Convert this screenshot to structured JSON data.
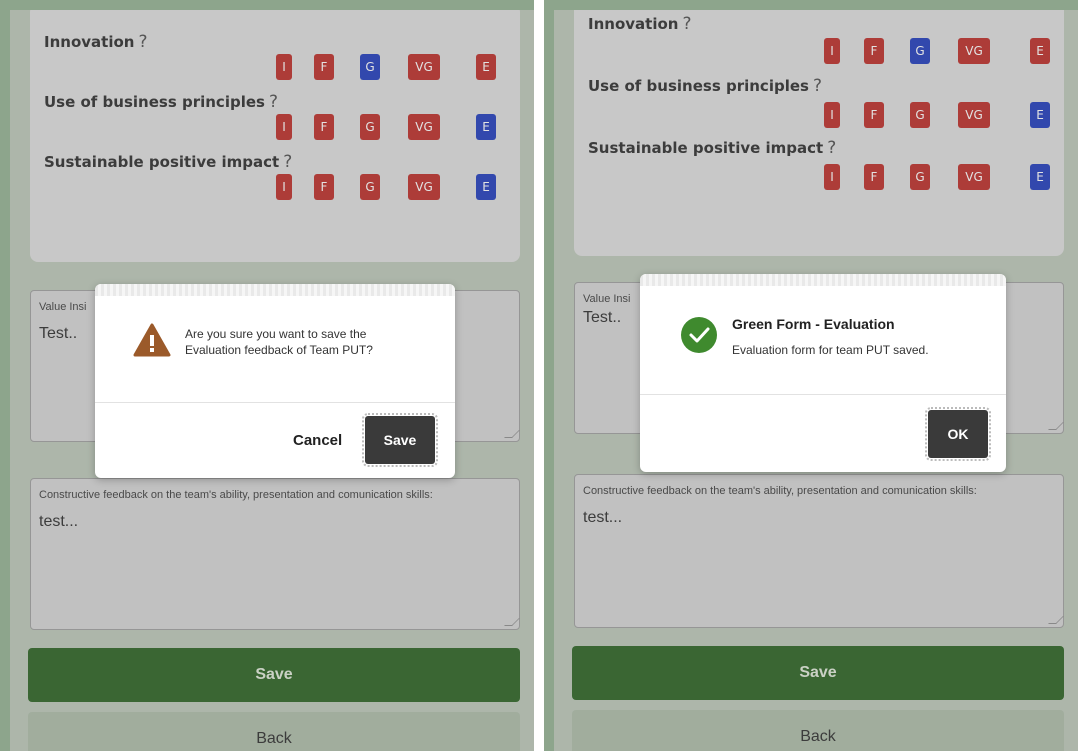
{
  "criteria": [
    {
      "label": "Innovation",
      "help": "?",
      "buttons": [
        "I",
        "F",
        "G",
        "VG",
        "E"
      ],
      "selected": "G"
    },
    {
      "label": "Use of business principles",
      "help": "?",
      "buttons": [
        "I",
        "F",
        "G",
        "VG",
        "E"
      ],
      "selected": "E"
    },
    {
      "label": "Sustainable positive impact",
      "help": "?",
      "buttons": [
        "I",
        "F",
        "G",
        "VG",
        "E"
      ],
      "selected": "E"
    }
  ],
  "value_insight": {
    "label": "Value Insi",
    "value": "Test.."
  },
  "constructive": {
    "label": "Constructive feedback on the team's ability, presentation and comunication skills:",
    "value": "test..."
  },
  "save_label": "Save",
  "back_label": "Back",
  "confirm_dialog": {
    "message_line1": "Are you sure you want to save the",
    "message_line2": "Evaluation feedback of Team PUT?",
    "cancel_label": "Cancel",
    "save_label": "Save",
    "icon": "warning-icon"
  },
  "success_dialog": {
    "title": "Green Form - Evaluation",
    "message": "Evaluation form for team PUT saved.",
    "ok_label": "OK",
    "icon": "check-circle-icon"
  },
  "colors": {
    "selected": "#1432b8",
    "unselected": "#b8221c",
    "primary": "#1f5a16"
  }
}
